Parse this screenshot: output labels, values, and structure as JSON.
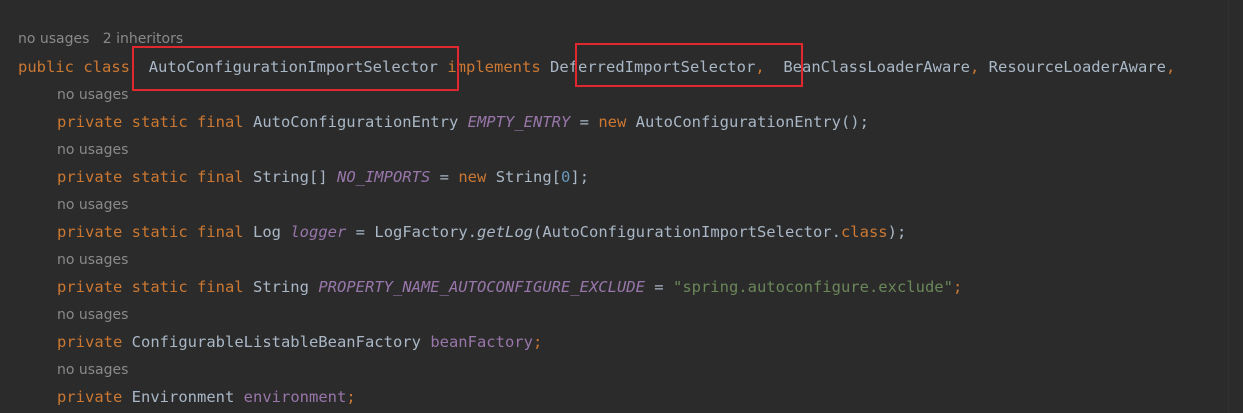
{
  "hints": {
    "class_usages": "no usages",
    "class_inheritors": "2 inheritors",
    "field_usages": "no usages"
  },
  "class_decl": {
    "kw_public": "public",
    "kw_class": "class",
    "class_name": "AutoConfigurationImportSelector",
    "kw_implements": "implements",
    "iface1": "DeferredImportSelector",
    "comma": ",",
    "iface2": "BeanClassLoaderAware",
    "iface3": "ResourceLoaderAware",
    "trail": ","
  },
  "fields": [
    {
      "mods": "private static final",
      "type": "AutoConfigurationEntry",
      "name": "EMPTY_ENTRY",
      "eq": "=",
      "kw_new": "new",
      "rhs": "AutoConfigurationEntry();"
    },
    {
      "mods": "private static final",
      "type": "String[]",
      "name": "NO_IMPORTS",
      "eq": "=",
      "kw_new": "new",
      "rhs_a": "String[",
      "rhs_num": "0",
      "rhs_b": "];"
    },
    {
      "mods": "private static final",
      "type": "Log",
      "name": "logger",
      "eq": "=",
      "rhs_a": "LogFactory.",
      "method": "getLog",
      "rhs_b": "(AutoConfigurationImportSelector.",
      "kw_class": "class",
      "rhs_c": ");"
    },
    {
      "mods": "private static final",
      "type": "String",
      "name": "PROPERTY_NAME_AUTOCONFIGURE_EXCLUDE",
      "eq": "=",
      "str": "\"spring.autoconfigure.exclude\"",
      "semi": ";"
    },
    {
      "mods": "private",
      "type": "ConfigurableListableBeanFactory",
      "name": "beanFactory",
      "semi": ";"
    },
    {
      "mods": "private",
      "type": "Environment",
      "name": "environment",
      "semi": ";"
    }
  ],
  "colors": {
    "background": "#2b2b2b",
    "keyword": "#cc7832",
    "text": "#a9b7c6",
    "constant": "#9876aa",
    "number": "#6897bb",
    "string": "#6a8759",
    "hint": "#8a8a8a",
    "highlight_box": "#e0282e"
  }
}
